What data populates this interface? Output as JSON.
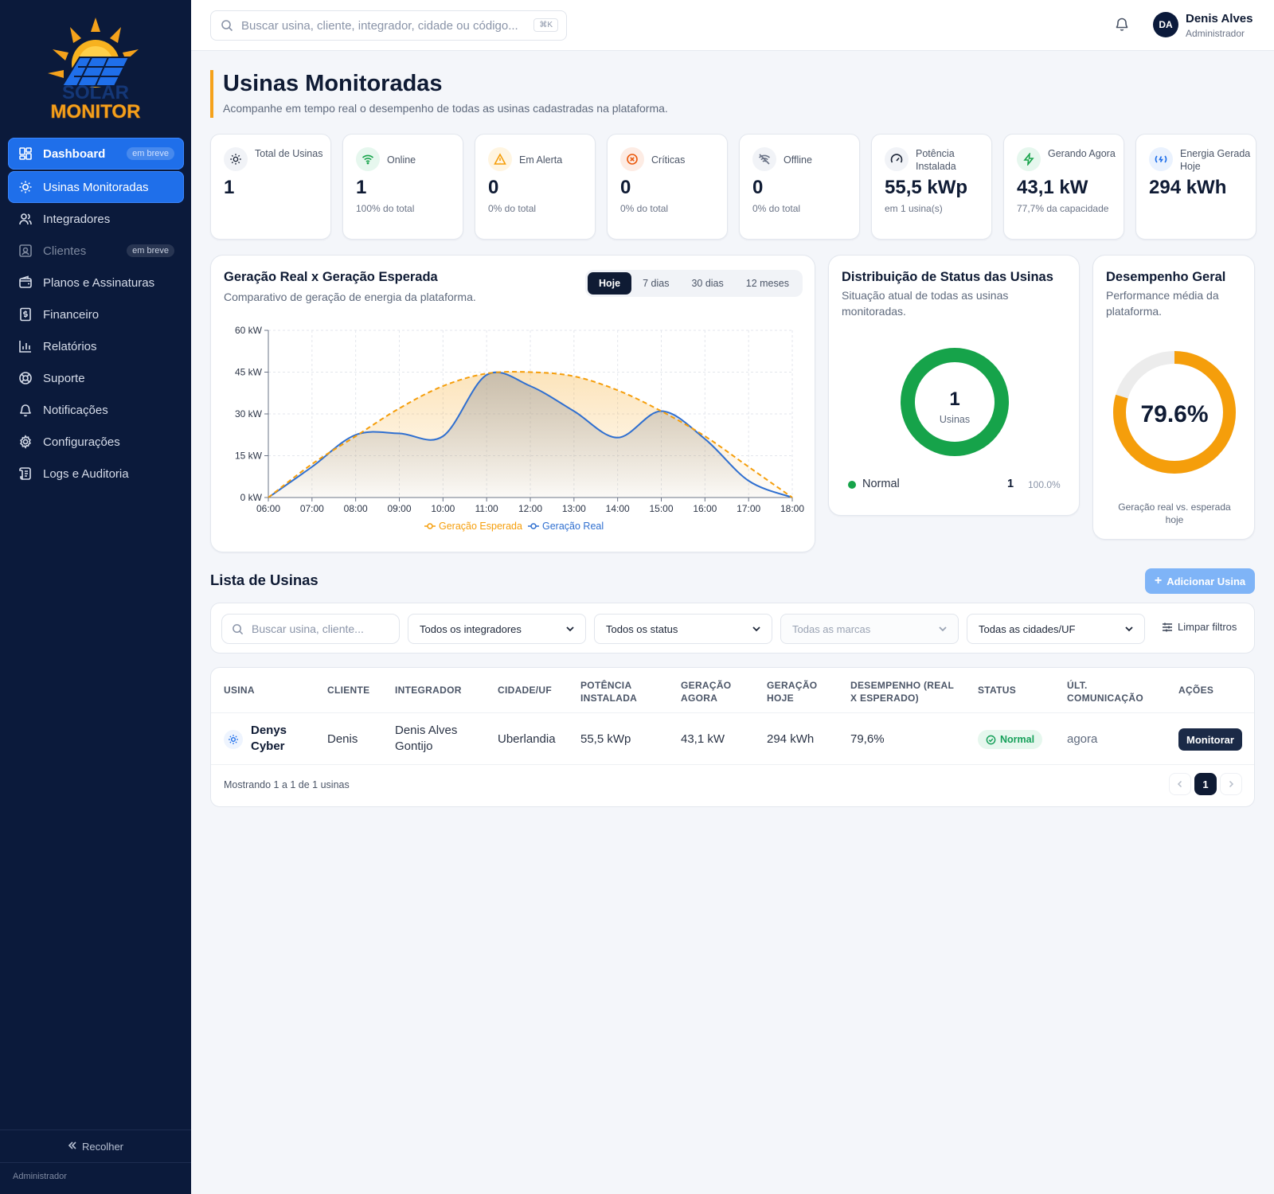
{
  "sidebar": {
    "logo_text_top": "SOLAR",
    "logo_text_bottom": "MONITOR",
    "items": [
      {
        "label": "Dashboard",
        "badge": "em breve"
      },
      {
        "label": "Usinas Monitoradas"
      },
      {
        "label": "Integradores"
      },
      {
        "label": "Clientes",
        "badge": "em breve"
      },
      {
        "label": "Planos e Assinaturas"
      },
      {
        "label": "Financeiro"
      },
      {
        "label": "Relatórios"
      },
      {
        "label": "Suporte"
      },
      {
        "label": "Notificações"
      },
      {
        "label": "Configurações"
      },
      {
        "label": "Logs e Auditoria"
      }
    ],
    "collapse_label": "Recolher",
    "footer_role": "Administrador"
  },
  "topbar": {
    "search_placeholder": "Buscar usina, cliente, integrador, cidade ou código...",
    "shortcut": "⌘K",
    "user_initials": "DA",
    "user_name": "Denis Alves",
    "user_role": "Administrador"
  },
  "header": {
    "title": "Usinas Monitoradas",
    "subtitle": "Acompanhe em tempo real o desempenho de todas as usinas cadastradas na plataforma."
  },
  "kpis": [
    {
      "label": "Total de Usinas",
      "value": "1",
      "sub": ""
    },
    {
      "label": "Online",
      "value": "1",
      "sub": "100% do total"
    },
    {
      "label": "Em Alerta",
      "value": "0",
      "sub": "0% do total"
    },
    {
      "label": "Críticas",
      "value": "0",
      "sub": "0% do total"
    },
    {
      "label": "Offline",
      "value": "0",
      "sub": "0% do total"
    },
    {
      "label": "Potência Instalada",
      "value": "55,5 kWp",
      "sub": "em 1 usina(s)"
    },
    {
      "label": "Gerando Agora",
      "value": "43,1 kW",
      "sub": "77,7% da capacidade"
    },
    {
      "label": "Energia Gerada Hoje",
      "value": "294 kWh",
      "sub": ""
    }
  ],
  "generation_panel": {
    "title": "Geração Real x Geração Esperada",
    "subtitle": "Comparativo de geração de energia da plataforma.",
    "ranges": [
      "Hoje",
      "7 dias",
      "30 dias",
      "12 meses"
    ],
    "selected_range": "Hoje"
  },
  "chart_data": {
    "type": "line",
    "x": [
      "06:00",
      "07:00",
      "08:00",
      "09:00",
      "10:00",
      "11:00",
      "12:00",
      "13:00",
      "14:00",
      "15:00",
      "16:00",
      "17:00",
      "18:00"
    ],
    "y_ticks": [
      "0 kW",
      "15 kW",
      "30 kW",
      "45 kW",
      "60 kW"
    ],
    "ylim": [
      0,
      60
    ],
    "grid": true,
    "legend_position": "bottom",
    "series": [
      {
        "name": "Geração Esperada",
        "color": "#f59e0b",
        "style": "dashed",
        "values": [
          0,
          12,
          22,
          32,
          40,
          44.5,
          45,
          43.5,
          38.5,
          31,
          22,
          11,
          0
        ]
      },
      {
        "name": "Geração Real",
        "color": "#2f6fd0",
        "style": "solid",
        "values": [
          0,
          11,
          22.5,
          23,
          22,
          44,
          40,
          31,
          21.5,
          31,
          21,
          6,
          0
        ]
      }
    ]
  },
  "status_panel": {
    "title": "Distribuição de Status das Usinas",
    "subtitle": "Situação atual de todas as usinas monitoradas.",
    "center_value": "1",
    "center_label": "Usinas",
    "legend": [
      {
        "label": "Normal",
        "count": "1",
        "pct": "100.0%",
        "color": "#16a34a"
      }
    ]
  },
  "performance_panel": {
    "title": "Desempenho Geral",
    "subtitle": "Performance média da plataforma.",
    "value_text": "79.6%",
    "value": 0.796,
    "caption": "Geração real vs. esperada hoje",
    "color": "#f59e0b"
  },
  "list": {
    "title": "Lista de Usinas",
    "add_button": "Adicionar Usina",
    "search_placeholder": "Buscar usina, cliente...",
    "filters": [
      "Todos os integradores",
      "Todos os status",
      "Todas as marcas",
      "Todas as cidades/UF"
    ],
    "clear_filters": "Limpar filtros",
    "columns": [
      "Usina",
      "Cliente",
      "Integrador",
      "Cidade/UF",
      "Potência Instalada",
      "Geração Agora",
      "Geração Hoje",
      "Desempenho (Real x Esperado)",
      "Status",
      "Últ. Comunicação",
      "Ações"
    ],
    "rows": [
      {
        "usina": "Denys Cyber",
        "cliente": "Denis",
        "integrador": "Denis Alves Gontijo",
        "cidade": "Uberlandia",
        "potencia": "55,5 kWp",
        "geracao_agora": "43,1 kW",
        "geracao_hoje": "294 kWh",
        "desempenho": "79,6%",
        "status": "Normal",
        "ultima": "agora",
        "acao": "Monitorar"
      }
    ],
    "footer": "Mostrando 1 a 1 de 1 usinas",
    "current_page": "1"
  }
}
